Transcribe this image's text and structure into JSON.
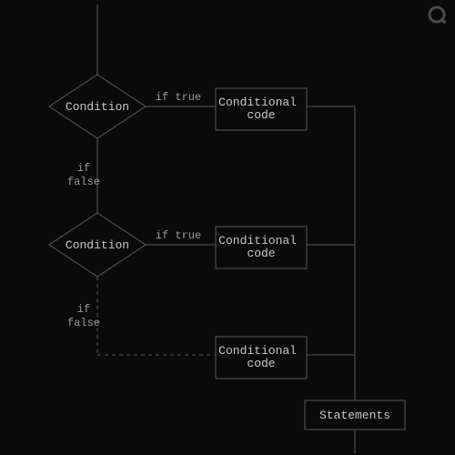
{
  "diagram": {
    "condition1": "Condition",
    "condition2": "Condition",
    "block1": "Conditional\ncode",
    "block2": "Conditional\ncode",
    "block3": "Conditional\ncode",
    "statements": "Statements",
    "true_label": "if true",
    "false_label1_line1": "if",
    "false_label1_line2": "false",
    "false_label2_line1": "if",
    "false_label2_line2": "false"
  }
}
